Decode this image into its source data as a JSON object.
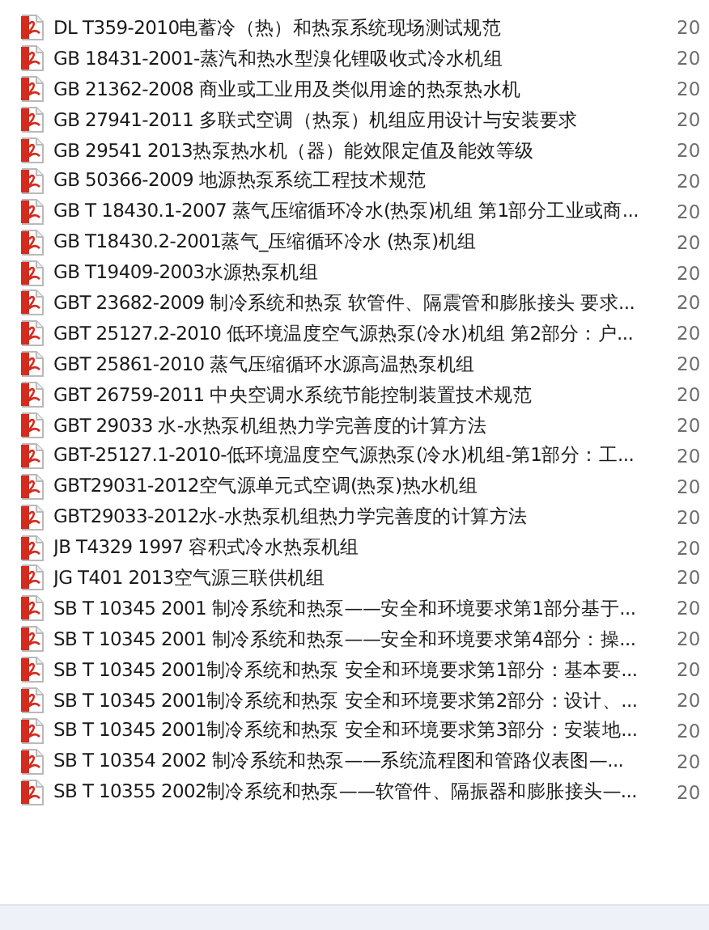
{
  "files": [
    {
      "name": "DL T359-2010电蓄冷（热）和热泵系统现场测试规范",
      "date": "20"
    },
    {
      "name": "GB 18431-2001-蒸汽和热水型溴化锂吸收式冷水机组",
      "date": "20"
    },
    {
      "name": "GB 21362-2008 商业或工业用及类似用途的热泵热水机",
      "date": "20"
    },
    {
      "name": "GB 27941-2011 多联式空调（热泵）机组应用设计与安装要求",
      "date": "20"
    },
    {
      "name": "GB 29541 2013热泵热水机（器）能效限定值及能效等级",
      "date": "20"
    },
    {
      "name": "GB 50366-2009 地源热泵系统工程技术规范",
      "date": "20"
    },
    {
      "name": "GB T 18430.1-2007 蒸气压缩循环冷水(热泵)机组 第1部分工业或商...",
      "date": "20"
    },
    {
      "name": "GB T18430.2-2001蒸气_压缩循环冷水 (热泵)机组",
      "date": "20"
    },
    {
      "name": "GB T19409-2003水源热泵机组",
      "date": "20"
    },
    {
      "name": "GBT 23682-2009 制冷系统和热泵 软管件、隔震管和膨胀接头 要求...",
      "date": "20"
    },
    {
      "name": "GBT 25127.2-2010 低环境温度空气源热泵(冷水)机组 第2部分：户...",
      "date": "20"
    },
    {
      "name": "GBT 25861-2010 蒸气压缩循环水源高温热泵机组",
      "date": "20"
    },
    {
      "name": "GBT 26759-2011 中央空调水系统节能控制装置技术规范",
      "date": "20"
    },
    {
      "name": "GBT 29033 水-水热泵机组热力学完善度的计算方法",
      "date": "20"
    },
    {
      "name": "GBT-25127.1-2010-低环境温度空气源热泵(冷水)机组-第1部分：工...",
      "date": "20"
    },
    {
      "name": "GBT29031-2012空气源单元式空调(热泵)热水机组",
      "date": "20"
    },
    {
      "name": "GBT29033-2012水-水热泵机组热力学完善度的计算方法",
      "date": "20"
    },
    {
      "name": "JB T4329 1997 容积式冷水热泵机组",
      "date": "20"
    },
    {
      "name": "JG T401 2013空气源三联供机组",
      "date": "20"
    },
    {
      "name": "SB T 10345 2001 制冷系统和热泵——安全和环境要求第1部分基于...",
      "date": "20"
    },
    {
      "name": "SB T 10345 2001 制冷系统和热泵——安全和环境要求第4部分：操...",
      "date": "20"
    },
    {
      "name": "SB T 10345 2001制冷系统和热泵 安全和环境要求第1部分：基本要...",
      "date": "20"
    },
    {
      "name": "SB T 10345 2001制冷系统和热泵 安全和环境要求第2部分：设计、...",
      "date": "20"
    },
    {
      "name": "SB T 10345 2001制冷系统和热泵 安全和环境要求第3部分：安装地...",
      "date": "20"
    },
    {
      "name": "SB T 10354 2002 制冷系统和热泵——系统流程图和管路仪表图—...",
      "date": "20"
    },
    {
      "name": "SB T 10355 2002制冷系统和热泵——软管件、隔振器和膨胀接头—...",
      "date": "20"
    }
  ]
}
